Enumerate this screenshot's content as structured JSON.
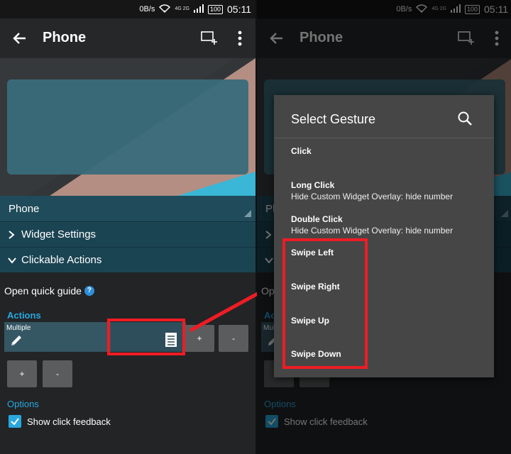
{
  "status_bar": {
    "net_speed": "0B/s",
    "signal": "4G 2G",
    "battery": "100",
    "time": "05:11"
  },
  "app_bar": {
    "title": "Phone"
  },
  "widget": {
    "name": "Phone"
  },
  "sections": {
    "widget_settings": "Widget Settings",
    "clickable_actions": "Clickable Actions"
  },
  "guide": {
    "label": "Open quick guide",
    "help": "?"
  },
  "actions": {
    "heading": "Actions",
    "item_caption": "Multiple",
    "plus": "+",
    "minus": "-"
  },
  "options": {
    "heading": "Options",
    "show_click_feedback": "Show click feedback",
    "show_click_feedback_checked": true
  },
  "dialog": {
    "title": "Select Gesture",
    "items": [
      {
        "name": "Click",
        "sub": ""
      },
      {
        "name": "Long Click",
        "sub": "Hide Custom Widget Overlay: hide number"
      },
      {
        "name": "Double Click",
        "sub": "Hide Custom Widget Overlay: hide number"
      },
      {
        "name": "Swipe Left",
        "sub": ""
      },
      {
        "name": "Swipe Right",
        "sub": ""
      },
      {
        "name": "Swipe Up",
        "sub": ""
      },
      {
        "name": "Swipe Down",
        "sub": ""
      }
    ]
  },
  "colors": {
    "accent": "#29a8e0",
    "highlight": "#ee1c24",
    "teal_bar": "#1b4453"
  }
}
